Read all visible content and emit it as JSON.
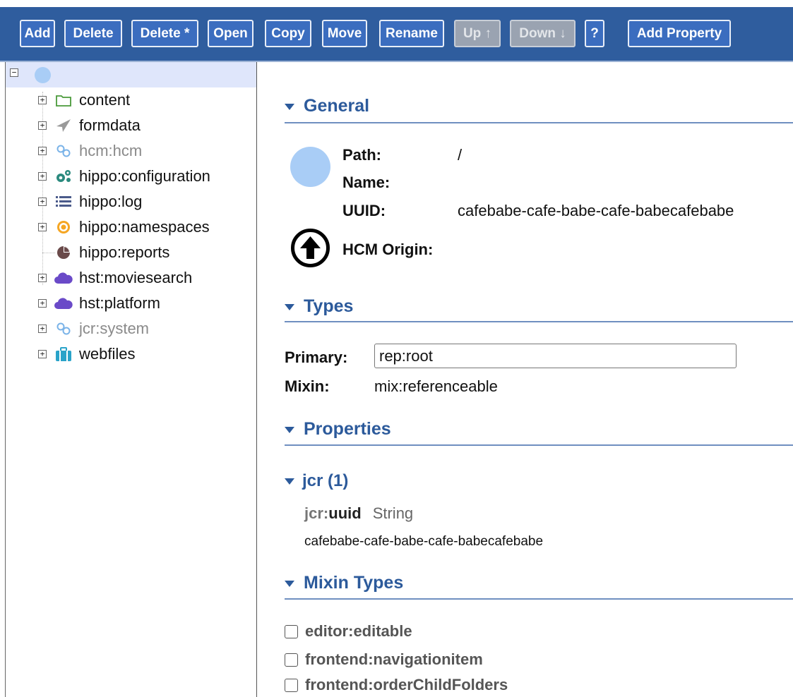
{
  "toolbar": {
    "buttons": [
      {
        "label": "Add"
      },
      {
        "label": "Delete"
      },
      {
        "label": "Delete *"
      },
      {
        "label": "Open"
      },
      {
        "label": "Copy"
      },
      {
        "label": "Move"
      },
      {
        "label": "Rename"
      },
      {
        "label": "Up ↑"
      },
      {
        "label": "Down ↓"
      },
      {
        "label": "?"
      },
      {
        "label": "Add Property"
      }
    ]
  },
  "tree": {
    "items": [
      {
        "label": "content",
        "icon": "folder-icon"
      },
      {
        "label": "formdata",
        "icon": "paper-plane-icon"
      },
      {
        "label": "hcm:hcm",
        "icon": "link-icon"
      },
      {
        "label": "hippo:configuration",
        "icon": "gears-icon"
      },
      {
        "label": "hippo:log",
        "icon": "list-icon"
      },
      {
        "label": "hippo:namespaces",
        "icon": "target-icon"
      },
      {
        "label": "hippo:reports",
        "icon": "pie-chart-icon"
      },
      {
        "label": "hst:moviesearch",
        "icon": "cloud-icon"
      },
      {
        "label": "hst:platform",
        "icon": "cloud-icon"
      },
      {
        "label": "jcr:system",
        "icon": "link-icon"
      },
      {
        "label": "webfiles",
        "icon": "suitcase-icon"
      }
    ]
  },
  "general": {
    "title": "General",
    "path_label": "Path:",
    "path_value": "/",
    "name_label": "Name:",
    "name_value": "",
    "uuid_label": "UUID:",
    "uuid_value": "cafebabe-cafe-babe-cafe-babecafebabe",
    "origin_label": "HCM Origin:"
  },
  "types": {
    "title": "Types",
    "primary_label": "Primary:",
    "primary_value": "rep:root",
    "mixin_label": "Mixin:",
    "mixin_value": "mix:referenceable"
  },
  "properties": {
    "title": "Properties",
    "group_label": "jcr (1)",
    "prop_ns": "jcr:",
    "prop_local": "uuid",
    "prop_type": "String",
    "prop_value": "cafebabe-cafe-babe-cafe-babecafebabe"
  },
  "mixin_types": {
    "title": "Mixin Types",
    "items": [
      {
        "label": "editor:editable"
      },
      {
        "label": "frontend:navigationitem"
      },
      {
        "label": "frontend:orderChildFolders"
      }
    ]
  },
  "colors": {
    "toolbar_bg": "#2f5d9e",
    "button_bg": "#3b6dbf",
    "section_heading": "#2c5a9b",
    "selected_row": "#dfe6fb",
    "node_circle": "#a9cdf6"
  }
}
